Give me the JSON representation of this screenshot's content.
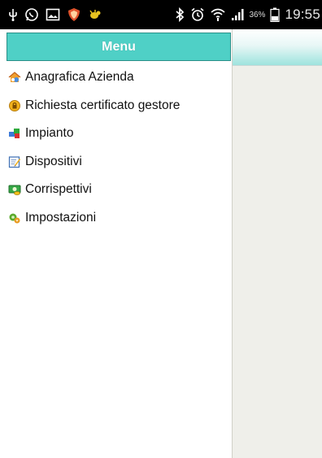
{
  "status_bar": {
    "icons": [
      "usb-icon",
      "whatsapp-icon",
      "gallery-icon",
      "shield-icon",
      "bug-icon",
      "bluetooth-icon",
      "alarm-icon",
      "wifi-icon",
      "signal-icon",
      "battery-icon"
    ],
    "battery_percent": "36%",
    "time": "19:55"
  },
  "menu": {
    "title": "Menu",
    "items": [
      {
        "label": "Anagrafica Azienda",
        "icon": "company-profile-icon"
      },
      {
        "label": "Richiesta certificato gestore",
        "icon": "certificate-request-icon"
      },
      {
        "label": "Impianto",
        "icon": "plant-icon"
      },
      {
        "label": "Dispositivi",
        "icon": "devices-icon"
      },
      {
        "label": "Corrispettivi",
        "icon": "payments-icon"
      },
      {
        "label": "Impostazioni",
        "icon": "settings-icon"
      }
    ]
  },
  "colors": {
    "menu_header_bg": "#4fd0c6",
    "content_bg": "#efefea",
    "status_bar_bg": "#000000"
  }
}
